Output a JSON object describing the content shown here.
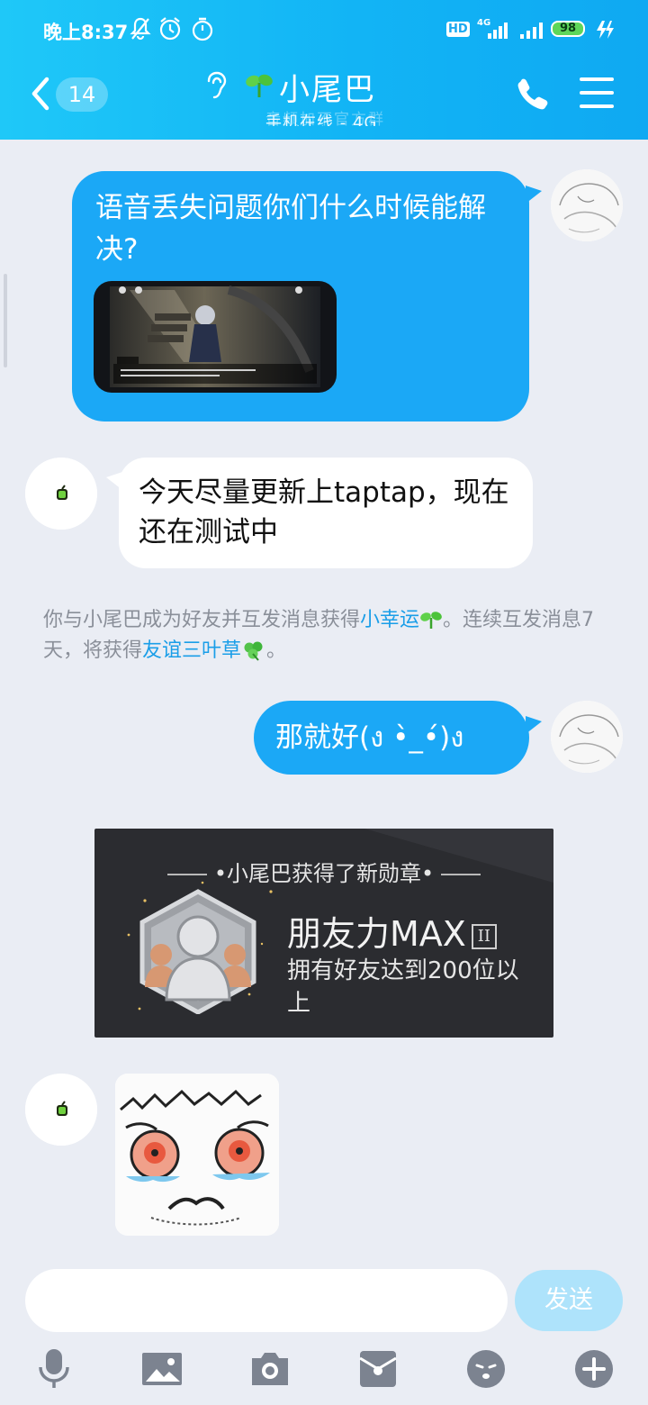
{
  "status_bar": {
    "time": "晚上8:37",
    "hd": "HD",
    "network": "4G",
    "battery": "98"
  },
  "header": {
    "unread_count": "14",
    "title": "小尾巴",
    "subtitle": "手机在线 - 4G",
    "subtitle_ghost": "音频加不官方群"
  },
  "messages": {
    "m1_text": "语音丢失问题你们什么时候能解决?",
    "m2_text": "今天尽量更新上taptap，现在还在测试中",
    "system": {
      "p1": "你与小尾巴成为好友并互发消息获得",
      "link1": "小幸运",
      "p2": "。连续互发消息7天，将获得",
      "link2": "友谊三叶草",
      "p3": "。"
    },
    "m3_text": "那就好(ง •̀_•́)ง",
    "medal": {
      "heading": "小尾巴获得了新勋章",
      "name": "朋友力MAX",
      "level": "II",
      "desc": "拥有好友达到200位以上"
    }
  },
  "input": {
    "placeholder": "",
    "value": "",
    "send_label": "发送"
  },
  "colors": {
    "header": "#12b4f5",
    "bubble_out": "#1ba8f6",
    "link": "#1a9ee8"
  }
}
